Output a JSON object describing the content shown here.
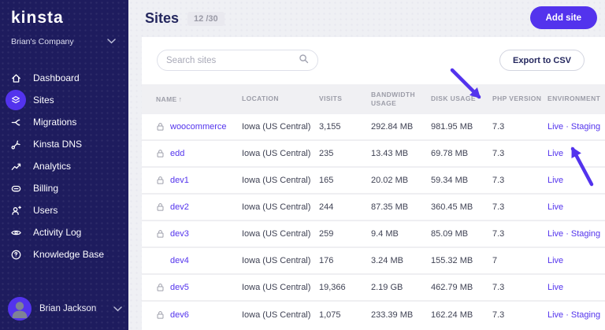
{
  "colors": {
    "accent": "#5333ED",
    "sidebar_bg": "#1E1C5E",
    "page_bg": "#EFF0F4",
    "link": "#5333ED",
    "arrow": "#5333ED"
  },
  "sidebar": {
    "logo": "Kinsta",
    "company": "Brian's Company",
    "items": [
      {
        "label": "Dashboard",
        "icon": "home-icon"
      },
      {
        "label": "Sites",
        "icon": "layers-icon",
        "active": true
      },
      {
        "label": "Migrations",
        "icon": "migration-fork-icon"
      },
      {
        "label": "Kinsta DNS",
        "icon": "dns-icon"
      },
      {
        "label": "Analytics",
        "icon": "analytics-icon"
      },
      {
        "label": "Billing",
        "icon": "billing-icon"
      },
      {
        "label": "Users",
        "icon": "user-add-icon"
      },
      {
        "label": "Activity Log",
        "icon": "eye-icon"
      },
      {
        "label": "Knowledge Base",
        "icon": "question-icon"
      }
    ],
    "user": {
      "name": "Brian Jackson"
    }
  },
  "header": {
    "title": "Sites",
    "count_badge": "12 /30",
    "add_button": "Add site"
  },
  "toolbar": {
    "search_placeholder": "Search sites",
    "export_button": "Export to CSV"
  },
  "table": {
    "sort_indicator": "↑",
    "columns": [
      "Name",
      "Location",
      "Visits",
      "Bandwidth Usage",
      "Disk Usage",
      "PHP Version",
      "Environment"
    ],
    "rows": [
      {
        "lock": true,
        "name": "woocommerce",
        "location": "Iowa (US Central)",
        "visits": "3,155",
        "bandwidth": "292.84 MB",
        "disk": "981.95 MB",
        "php": "7.3",
        "live": "Live",
        "sep": "·",
        "staging": "Staging"
      },
      {
        "lock": true,
        "name": "edd",
        "location": "Iowa (US Central)",
        "visits": "235",
        "bandwidth": "13.43 MB",
        "disk": "69.78 MB",
        "php": "7.3",
        "live": "Live"
      },
      {
        "lock": true,
        "name": "dev1",
        "location": "Iowa (US Central)",
        "visits": "165",
        "bandwidth": "20.02 MB",
        "disk": "59.34 MB",
        "php": "7.3",
        "live": "Live"
      },
      {
        "lock": true,
        "name": "dev2",
        "location": "Iowa (US Central)",
        "visits": "244",
        "bandwidth": "87.35 MB",
        "disk": "360.45 MB",
        "php": "7.3",
        "live": "Live"
      },
      {
        "lock": true,
        "name": "dev3",
        "location": "Iowa (US Central)",
        "visits": "259",
        "bandwidth": "9.4 MB",
        "disk": "85.09 MB",
        "php": "7.3",
        "live": "Live",
        "sep": "·",
        "staging": "Staging"
      },
      {
        "lock": false,
        "name": "dev4",
        "location": "Iowa (US Central)",
        "visits": "176",
        "bandwidth": "3.24 MB",
        "disk": "155.32 MB",
        "php": "7",
        "live": "Live"
      },
      {
        "lock": true,
        "name": "dev5",
        "location": "Iowa (US Central)",
        "visits": "19,366",
        "bandwidth": "2.19 GB",
        "disk": "462.79 MB",
        "php": "7.3",
        "live": "Live"
      },
      {
        "lock": true,
        "name": "dev6",
        "location": "Iowa (US Central)",
        "visits": "1,075",
        "bandwidth": "233.39 MB",
        "disk": "162.24 MB",
        "php": "7.3",
        "live": "Live",
        "sep": "·",
        "staging": "Staging"
      }
    ]
  }
}
